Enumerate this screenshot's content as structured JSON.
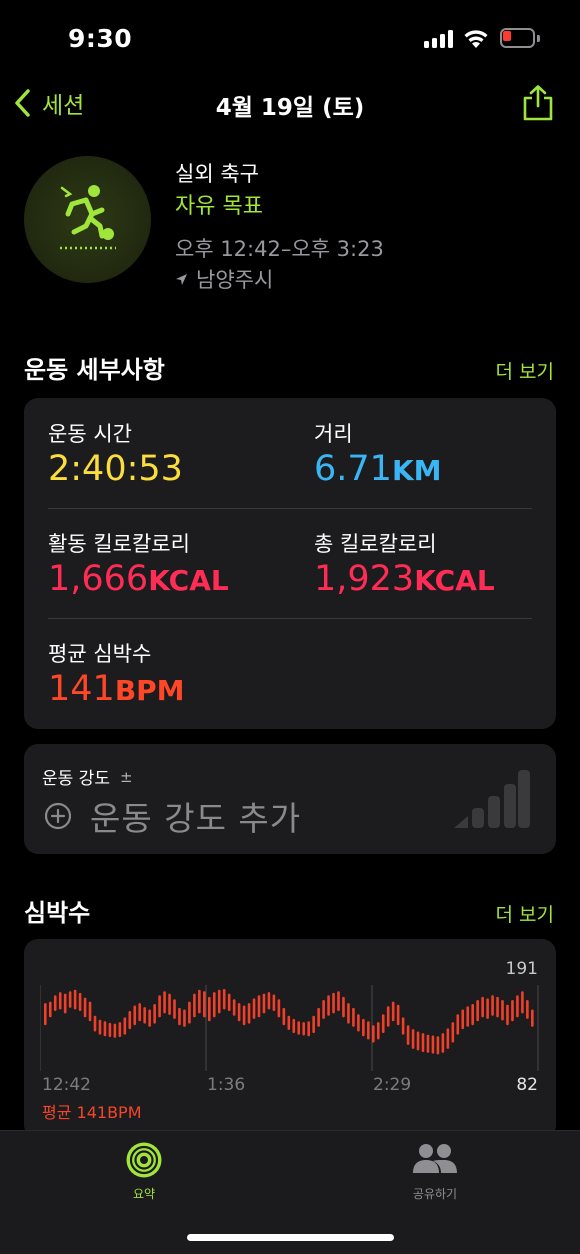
{
  "status": {
    "time": "9:30"
  },
  "nav": {
    "back_label": "세션",
    "title": "4월 19일 (토)"
  },
  "workout": {
    "name": "실외 축구",
    "goal": "자유 목표",
    "time_range": "오후 12:42–오후 3:23",
    "location": "남양주시"
  },
  "details": {
    "section_title": "운동 세부사항",
    "see_more": "더 보기",
    "duration": {
      "label": "운동 시간",
      "value": "2:40:53",
      "color": "#fbde3e"
    },
    "distance": {
      "label": "거리",
      "value": "6.71",
      "unit": "KM",
      "color": "#3ab6f5"
    },
    "active_cal": {
      "label": "활동 킬로칼로리",
      "value": "1,666",
      "unit": "KCAL",
      "color": "#ff2d55"
    },
    "total_cal": {
      "label": "총 킬로칼로리",
      "value": "1,923",
      "unit": "KCAL",
      "color": "#ff2d55"
    },
    "avg_hr": {
      "label": "평균 심박수",
      "value": "141",
      "unit": "BPM",
      "color": "#ff4728"
    }
  },
  "intensity": {
    "label": "운동 강도",
    "label_symbol": "±",
    "add_label": "운동 강도 추가"
  },
  "heart_rate": {
    "section_title": "심박수",
    "see_more": "더 보기",
    "max_label": "191",
    "min_label": "82",
    "x_labels": [
      "12:42",
      "1:36",
      "2:29"
    ],
    "avg_label": "평균 141BPM",
    "chart_data": {
      "type": "bar",
      "ylim": [
        82,
        191
      ],
      "ranges": [
        [
          140,
          168
        ],
        [
          150,
          170
        ],
        [
          158,
          178
        ],
        [
          160,
          182
        ],
        [
          155,
          180
        ],
        [
          162,
          183
        ],
        [
          160,
          185
        ],
        [
          158,
          181
        ],
        [
          150,
          175
        ],
        [
          145,
          170
        ],
        [
          132,
          152
        ],
        [
          128,
          147
        ],
        [
          126,
          145
        ],
        [
          125,
          143
        ],
        [
          124,
          142
        ],
        [
          125,
          144
        ],
        [
          128,
          150
        ],
        [
          135,
          158
        ],
        [
          140,
          165
        ],
        [
          145,
          168
        ],
        [
          142,
          163
        ],
        [
          138,
          160
        ],
        [
          142,
          167
        ],
        [
          150,
          178
        ],
        [
          155,
          183
        ],
        [
          153,
          180
        ],
        [
          148,
          173
        ],
        [
          140,
          162
        ],
        [
          138,
          160
        ],
        [
          142,
          170
        ],
        [
          150,
          180
        ],
        [
          155,
          185
        ],
        [
          150,
          183
        ],
        [
          145,
          176
        ],
        [
          150,
          182
        ],
        [
          155,
          185
        ],
        [
          160,
          186
        ],
        [
          158,
          180
        ],
        [
          152,
          173
        ],
        [
          145,
          168
        ],
        [
          140,
          165
        ],
        [
          142,
          168
        ],
        [
          148,
          174
        ],
        [
          150,
          178
        ],
        [
          155,
          180
        ],
        [
          160,
          182
        ],
        [
          158,
          179
        ],
        [
          150,
          173
        ],
        [
          140,
          162
        ],
        [
          134,
          152
        ],
        [
          130,
          148
        ],
        [
          128,
          145
        ],
        [
          127,
          144
        ],
        [
          126,
          145
        ],
        [
          130,
          152
        ],
        [
          138,
          162
        ],
        [
          148,
          172
        ],
        [
          152,
          178
        ],
        [
          155,
          181
        ],
        [
          158,
          183
        ],
        [
          150,
          176
        ],
        [
          142,
          168
        ],
        [
          138,
          162
        ],
        [
          132,
          154
        ],
        [
          126,
          148
        ],
        [
          122,
          145
        ],
        [
          118,
          140
        ],
        [
          122,
          144
        ],
        [
          130,
          154
        ],
        [
          138,
          164
        ],
        [
          145,
          170
        ],
        [
          140,
          166
        ],
        [
          128,
          150
        ],
        [
          115,
          140
        ],
        [
          110,
          135
        ],
        [
          108,
          132
        ],
        [
          106,
          130
        ],
        [
          105,
          128
        ],
        [
          104,
          127
        ],
        [
          103,
          126
        ],
        [
          105,
          130
        ],
        [
          110,
          136
        ],
        [
          118,
          144
        ],
        [
          128,
          154
        ],
        [
          135,
          160
        ],
        [
          138,
          164
        ],
        [
          140,
          167
        ],
        [
          145,
          172
        ],
        [
          150,
          176
        ],
        [
          148,
          174
        ],
        [
          152,
          178
        ],
        [
          150,
          176
        ],
        [
          146,
          172
        ],
        [
          140,
          166
        ],
        [
          145,
          172
        ],
        [
          150,
          178
        ],
        [
          155,
          183
        ],
        [
          148,
          172
        ],
        [
          138,
          160
        ]
      ]
    }
  },
  "tabs": {
    "summary": {
      "label": "요약",
      "color": "#a0e53c"
    },
    "share": {
      "label": "공유하기",
      "color": "#8e8e93"
    }
  }
}
